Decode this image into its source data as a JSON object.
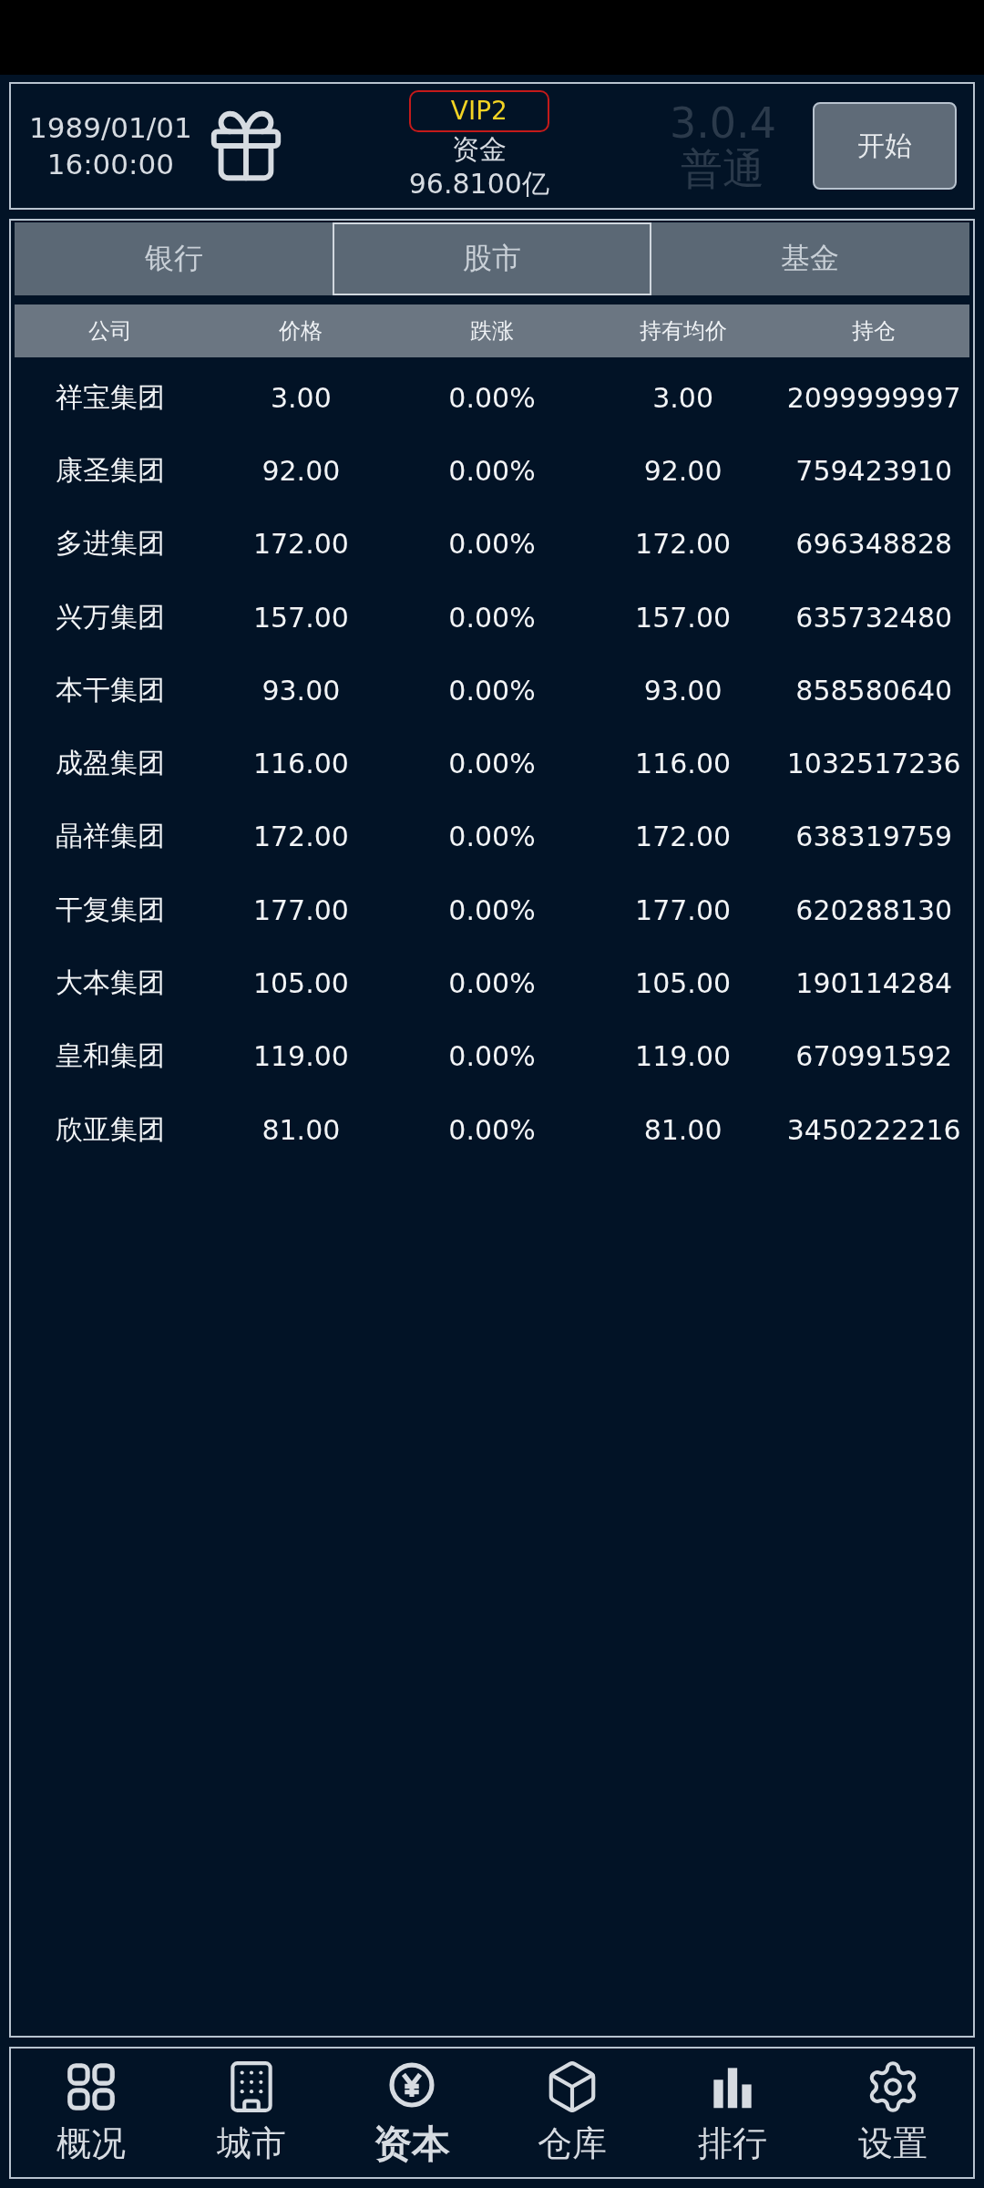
{
  "header": {
    "date": "1989/01/01",
    "time": "16:00:00",
    "vip": "VIP2",
    "funds_label": "资金",
    "funds": "96.8100亿",
    "version": "3.0.4",
    "mode": "普通",
    "start_button": "开始"
  },
  "tabs": [
    {
      "label": "银行",
      "selected": false
    },
    {
      "label": "股市",
      "selected": true
    },
    {
      "label": "基金",
      "selected": false
    }
  ],
  "table": {
    "columns": [
      "公司",
      "价格",
      "跌涨",
      "持有均价",
      "持仓"
    ],
    "rows": [
      [
        "祥宝集团",
        "3.00",
        "0.00%",
        "3.00",
        "2099999997"
      ],
      [
        "康圣集团",
        "92.00",
        "0.00%",
        "92.00",
        "759423910"
      ],
      [
        "多进集团",
        "172.00",
        "0.00%",
        "172.00",
        "696348828"
      ],
      [
        "兴万集团",
        "157.00",
        "0.00%",
        "157.00",
        "635732480"
      ],
      [
        "本干集团",
        "93.00",
        "0.00%",
        "93.00",
        "858580640"
      ],
      [
        "成盈集团",
        "116.00",
        "0.00%",
        "116.00",
        "1032517236"
      ],
      [
        "晶祥集团",
        "172.00",
        "0.00%",
        "172.00",
        "638319759"
      ],
      [
        "干复集团",
        "177.00",
        "0.00%",
        "177.00",
        "620288130"
      ],
      [
        "大本集团",
        "105.00",
        "0.00%",
        "105.00",
        "190114284"
      ],
      [
        "皇和集团",
        "119.00",
        "0.00%",
        "119.00",
        "670991592"
      ],
      [
        "欣亚集团",
        "81.00",
        "0.00%",
        "81.00",
        "3450222216"
      ]
    ]
  },
  "nav": [
    {
      "label": "概况",
      "kind": "grid",
      "selected": false
    },
    {
      "label": "城市",
      "kind": "building",
      "selected": false
    },
    {
      "label": "资本",
      "kind": "yen",
      "selected": true
    },
    {
      "label": "仓库",
      "kind": "box",
      "selected": false
    },
    {
      "label": "排行",
      "kind": "bars",
      "selected": false
    },
    {
      "label": "设置",
      "kind": "gear",
      "selected": false
    }
  ]
}
